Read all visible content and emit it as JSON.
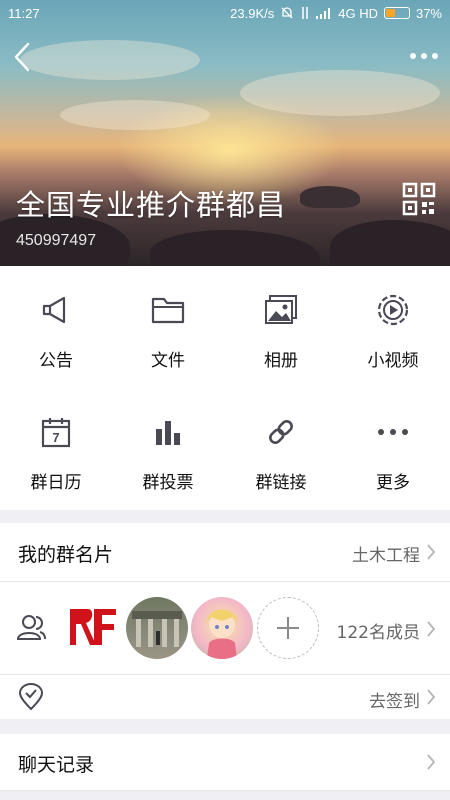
{
  "status_bar": {
    "time": "11:27",
    "speed": "23.9K/s",
    "network": "4G HD",
    "battery": "37%",
    "battery_level": 0.37
  },
  "header": {
    "group_name": "全国专业推介群都昌",
    "group_id": "450997497",
    "back_icon": "chevron-left-icon",
    "more_icon": "more-dots-icon",
    "qr_icon": "qr-code-icon"
  },
  "features": [
    {
      "label": "公告",
      "icon": "megaphone-icon"
    },
    {
      "label": "文件",
      "icon": "folder-icon"
    },
    {
      "label": "相册",
      "icon": "photo-album-icon"
    },
    {
      "label": "小视频",
      "icon": "video-icon"
    },
    {
      "label": "群日历",
      "icon": "calendar-icon"
    },
    {
      "label": "群投票",
      "icon": "poll-icon"
    },
    {
      "label": "群链接",
      "icon": "link-icon"
    },
    {
      "label": "更多",
      "icon": "more-icon"
    }
  ],
  "calendar_day": "7",
  "card": {
    "title": "我的群名片",
    "value": "土木工程"
  },
  "members": {
    "count_label": "122名成员"
  },
  "checkin": {
    "label": "去签到"
  },
  "chat": {
    "title": "聊天记录"
  },
  "colors": {
    "accent": "#f7a62a",
    "icon_gray": "#4a4a55"
  }
}
